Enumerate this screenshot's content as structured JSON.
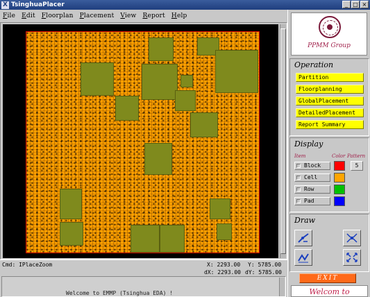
{
  "window": {
    "title": "TsinghuaPlacer"
  },
  "menu": [
    "File",
    "Edit",
    "Floorplan",
    "Placement",
    "View",
    "Report",
    "Help"
  ],
  "command": {
    "text": "Cmd: IPlaceZoom"
  },
  "coords": {
    "x": "X: 2293.00",
    "y": "Y: 5785.00",
    "dx": "dX: 2293.00",
    "dy": "dY: 5785.00"
  },
  "console": {
    "message": "Welcome to EMMP (Tsinghua EDA) !"
  },
  "logo": {
    "group": "PPMM Group"
  },
  "operation": {
    "title": "Operation",
    "buttons": [
      "Partition",
      "Floorplanning",
      "GlobalPlacement",
      "DetailedPlacement",
      "Report Summary"
    ]
  },
  "display": {
    "title": "Display",
    "headers": {
      "item": "Item",
      "color": "Color",
      "pattern": "Pattern"
    },
    "items": [
      {
        "label": "Block",
        "color": "#ff0000",
        "pattern": "5"
      },
      {
        "label": "Cell",
        "color": "#ffa500"
      },
      {
        "label": "Row",
        "color": "#00c000"
      },
      {
        "label": "Pad",
        "color": "#0000ff"
      }
    ]
  },
  "draw": {
    "title": "Draw"
  },
  "exit": {
    "label": "EXIT"
  },
  "welcome": {
    "text": "Welcom to"
  },
  "colors": {
    "cell": "#ffa000",
    "macro": "#7f8a1d",
    "canvas": "#000000",
    "die_border": "#cc0000"
  }
}
